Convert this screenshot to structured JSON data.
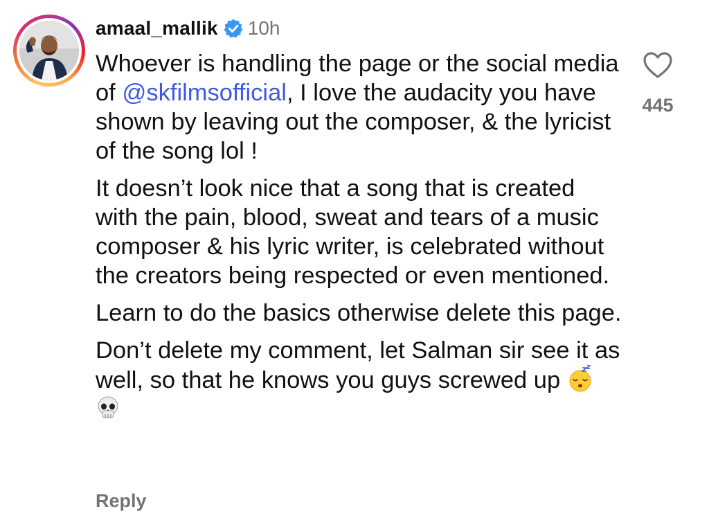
{
  "comment": {
    "username": "amaal_mallik",
    "timestamp": "10h",
    "verified": true,
    "verified_icon": "verified-badge-icon",
    "brand_color": "#3897f0",
    "mention_color": "#3f5ae0",
    "paragraphs": [
      {
        "before_mention": "Whoever is handling the page or the social media of ",
        "mention": "@skfilmsofficial",
        "after_mention": ", I love the audacity you have shown by leaving out the composer, & the lyricist of the song lol !"
      },
      {
        "text": "It doesn’t look nice that a song that is created with the pain, blood, sweat and tears of a music composer & his lyric writer, is celebrated without the creators being respected or even mentioned."
      },
      {
        "text": "Learn to do the basics otherwise delete this page."
      },
      {
        "text": "Don’t delete my comment, let Salman sir see it as well, so that he knows you guys screwed up",
        "emojis": [
          "😴",
          "💀"
        ]
      }
    ],
    "like_count": "445",
    "like_icon": "heart-outline-icon",
    "reply_label": "Reply"
  }
}
